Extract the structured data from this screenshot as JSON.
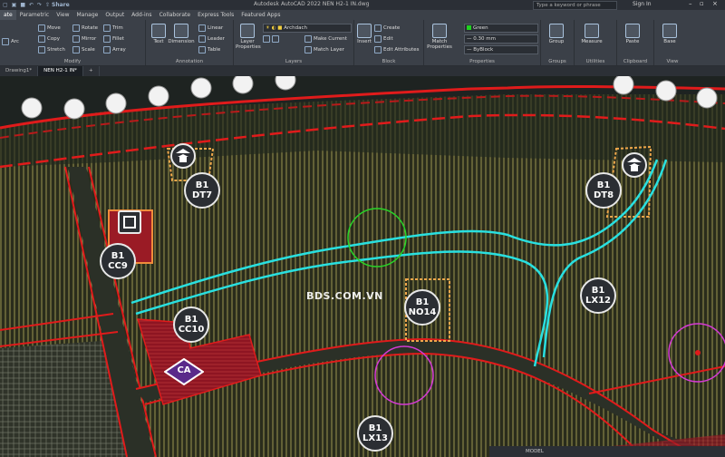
{
  "titlebar": {
    "share_label": "Share",
    "app_title": "Autodesk AutoCAD 2022   NEN H2-1 IN.dwg",
    "search_placeholder": "Type a keyword or phrase",
    "signin": "Sign In"
  },
  "menu": [
    "ate",
    "Parametric",
    "View",
    "Manage",
    "Output",
    "Add-ins",
    "Collaborate",
    "Express Tools",
    "Featured Apps"
  ],
  "ribbon": {
    "modify": {
      "title": "Modify",
      "tools": [
        "Move",
        "Rotate",
        "Trim",
        "Copy",
        "Mirror",
        "Fillet",
        "Stretch",
        "Scale",
        "Array"
      ]
    },
    "draw": {
      "arc_label": "Arc"
    },
    "annotation": {
      "title": "Annotation",
      "text": "Text",
      "dimension": "Dimension",
      "linear": "Linear",
      "leader": "Leader",
      "table": "Table"
    },
    "layers": {
      "title": "Layers",
      "layer_properties": "Layer Properties",
      "current_layer": "Archdach",
      "make_current": "Make Current",
      "match_layer": "Match Layer"
    },
    "block": {
      "title": "Block",
      "insert": "Insert",
      "create": "Create",
      "edit": "Edit",
      "edit_attributes": "Edit Attributes"
    },
    "properties": {
      "title": "Properties",
      "match": "Match Properties",
      "color": "Green",
      "lineweight": "0.30 mm",
      "linetype": "ByBlock"
    },
    "groups": {
      "title": "Groups",
      "group": "Group"
    },
    "utilities": {
      "title": "Utilities",
      "measure": "Measure"
    },
    "clipboard": {
      "title": "Clipboard",
      "paste": "Paste"
    },
    "view": {
      "title": "View",
      "base": "Base"
    }
  },
  "tabs": [
    "Drawing1*",
    "NEN H2-1 IN*"
  ],
  "map_labels": {
    "dt7": [
      "B1",
      "DT7"
    ],
    "dt8": [
      "B1",
      "DT8"
    ],
    "cc9": [
      "B1",
      "CC9"
    ],
    "cc10": [
      "B1",
      "CC10"
    ],
    "no14": [
      "B1",
      "NO14"
    ],
    "lx12": [
      "B1",
      "LX12"
    ],
    "lx13": [
      "B1",
      "LX13"
    ],
    "ca": "CA"
  },
  "watermark": "BDS.COM.VN",
  "status": {
    "model": "MODEL"
  },
  "colors": {
    "road": "#e01b1b",
    "canal": "#29e0e0",
    "grid": "#d8d35a",
    "plot": "#b0202a",
    "accent": "#f0a74b"
  }
}
